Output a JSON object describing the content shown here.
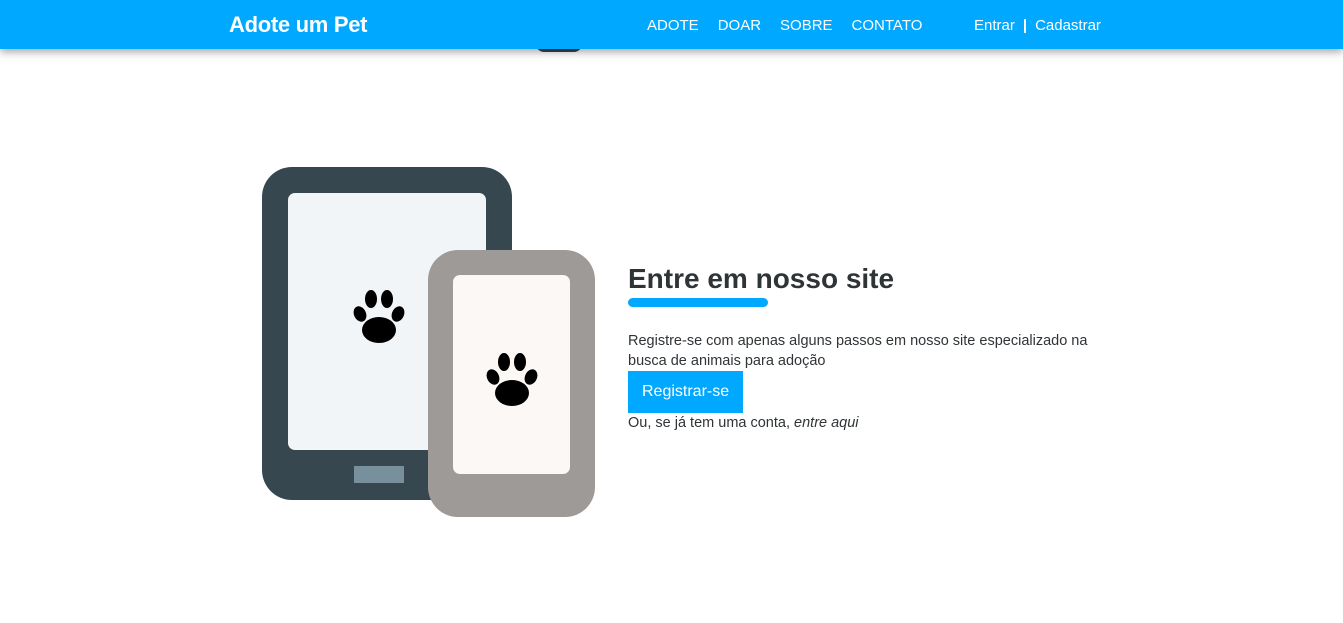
{
  "navbar": {
    "brand": "Adote um Pet",
    "links": [
      "ADOTE",
      "DOAR",
      "SOBRE",
      "CONTATO"
    ],
    "auth": {
      "login": "Entrar",
      "separator": "|",
      "signup": "Cadastrar"
    },
    "color": "#00a8ff"
  },
  "hero": {
    "title": "Entre em nosso site",
    "description": "Registre-se com apenas alguns passos em nosso site especializado na busca de animais para adoção",
    "button_label": "Registrar-se",
    "login_prefix": "Ou, se já tem uma conta, ",
    "login_link": "entre aqui"
  },
  "illustration": {
    "tablet_icon": "paw-icon",
    "phone_icon": "paw-icon",
    "tablet_color": "#37474f",
    "phone_color": "#9e9a97"
  }
}
